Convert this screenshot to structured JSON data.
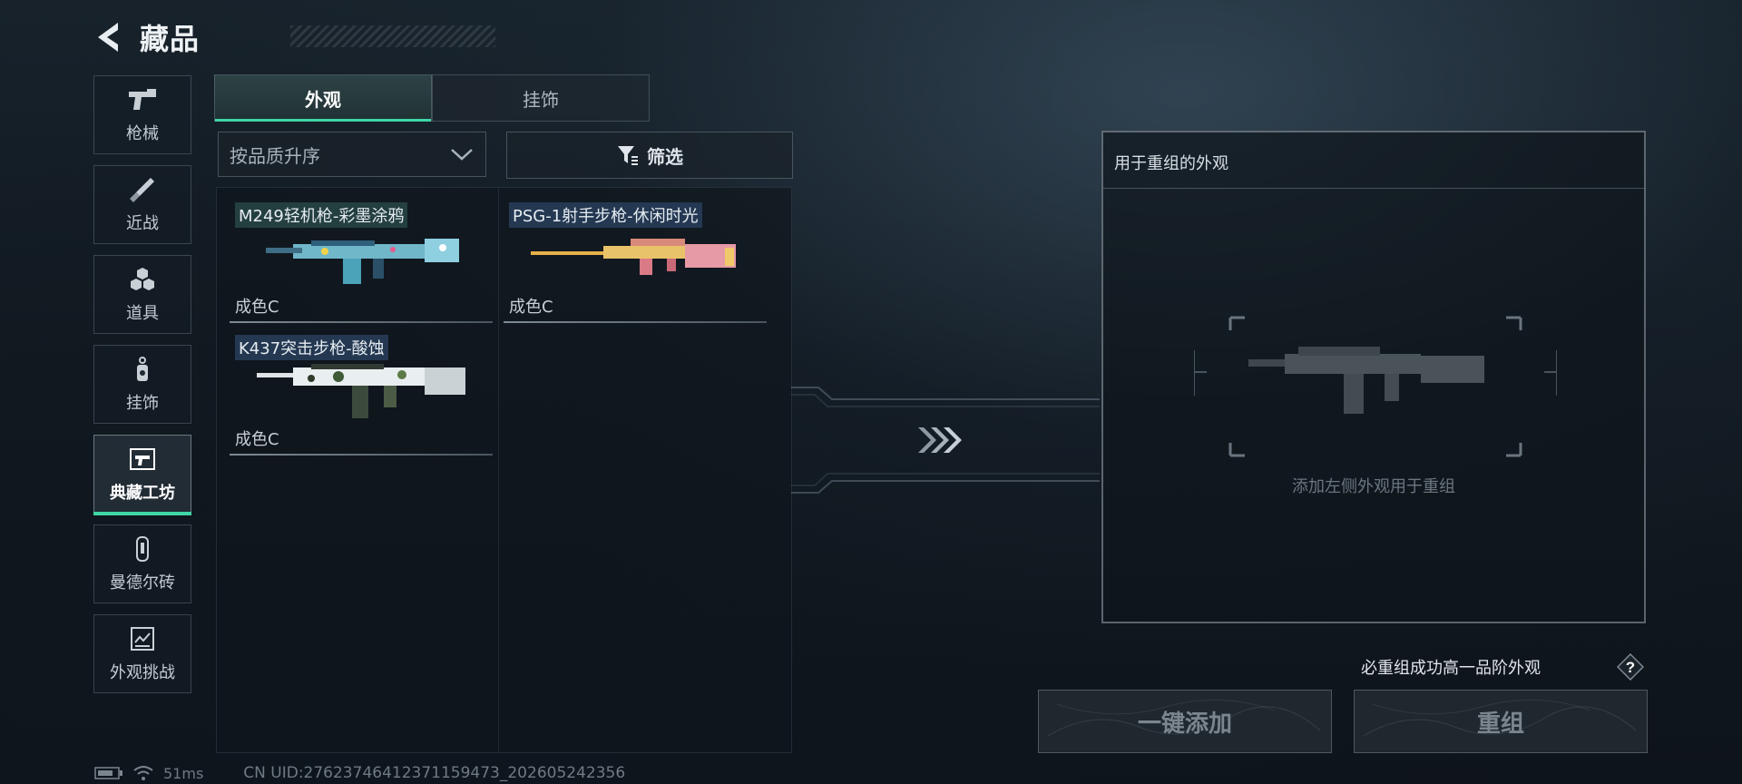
{
  "header": {
    "title": "藏品"
  },
  "sidebar": {
    "items": [
      {
        "label": "枪械",
        "icon": "pistol-icon",
        "active": false
      },
      {
        "label": "近战",
        "icon": "knife-icon",
        "active": false
      },
      {
        "label": "道具",
        "icon": "grenade-icon",
        "active": false
      },
      {
        "label": "挂饰",
        "icon": "charm-icon",
        "active": false
      },
      {
        "label": "典藏工坊",
        "icon": "workshop-icon",
        "active": true
      },
      {
        "label": "曼德尔砖",
        "icon": "brick-icon",
        "active": false
      },
      {
        "label": "外观挑战",
        "icon": "challenge-icon",
        "active": false
      }
    ]
  },
  "tabs": [
    {
      "label": "外观",
      "active": true
    },
    {
      "label": "挂饰",
      "active": false
    }
  ],
  "sort": {
    "value": "按品质升序"
  },
  "filter": {
    "label": "筛选"
  },
  "items": [
    {
      "name": "M249轻机枪-彩墨涂鸦",
      "grade": "成色C"
    },
    {
      "name": "PSG-1射手步枪-休闲时光",
      "grade": "成色C"
    },
    {
      "name": "K437突击步枪-酸蚀",
      "grade": "成色C"
    }
  ],
  "remake": {
    "title": "用于重组的外观",
    "hint": "添加左侧外观用于重组",
    "notice": "必重组成功高一品阶外观",
    "add_button": "一键添加",
    "remake_button": "重组"
  },
  "status": {
    "ping": "51ms",
    "uid": "CN UID:27623746412371159473_202605242356"
  },
  "colors": {
    "accent": "#3fd6a5",
    "background": "#121a22"
  }
}
